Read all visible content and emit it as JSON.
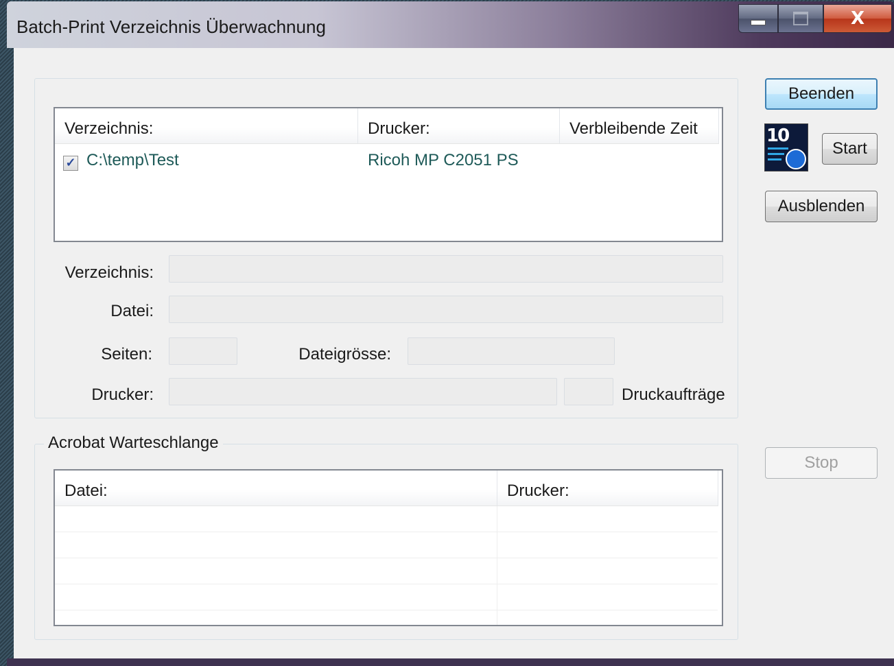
{
  "window": {
    "title": "Batch-Print Verzeichnis Überwachnung",
    "close_glyph": "X"
  },
  "directory_list": {
    "columns": [
      "Verzeichnis:",
      "Drucker:",
      "Verbleibende Zeit"
    ],
    "rows": [
      {
        "checked": true,
        "directory": "C:\\temp\\Test",
        "printer": "Ricoh MP C2051 PS",
        "remaining": ""
      }
    ]
  },
  "details": {
    "directory_label": "Verzeichnis:",
    "directory_value": "",
    "file_label": "Datei:",
    "file_value": "",
    "pages_label": "Seiten:",
    "pages_value": "",
    "filesize_label": "Dateigrösse:",
    "filesize_value": "",
    "printer_label": "Drucker:",
    "printer_value": "",
    "jobs_value": "",
    "jobs_label": "Druckaufträge"
  },
  "acrobat_queue": {
    "group_label": "Acrobat Warteschlange",
    "columns": [
      "Datei:",
      "Drucker:"
    ],
    "rows": []
  },
  "buttons": {
    "quit": "Beenden",
    "start": "Start",
    "hide": "Ausblenden",
    "stop": "Stop"
  },
  "icons": {
    "timer_icon_number": "10",
    "checkbox_glyph": "✓"
  },
  "colors": {
    "list_text": "#1e5a58",
    "default_button_border": "#3c7fb1"
  }
}
